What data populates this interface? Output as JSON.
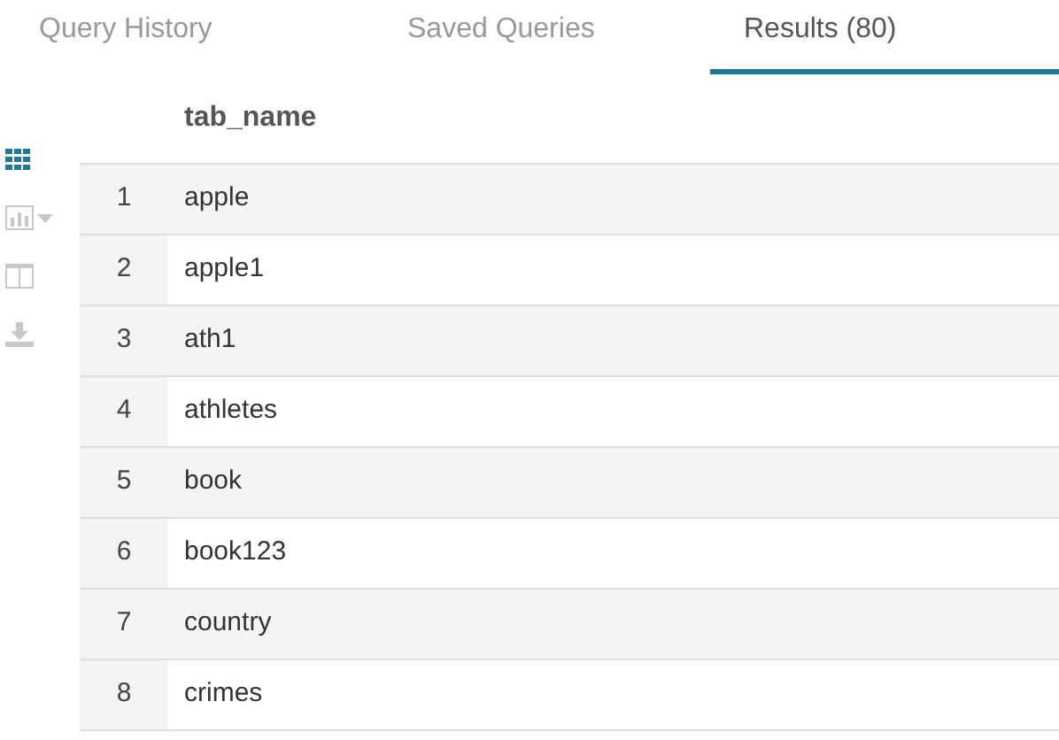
{
  "tabs": [
    {
      "label": "Query History",
      "selected": false
    },
    {
      "label": "Saved Queries",
      "selected": false
    },
    {
      "label": "Results (80)",
      "selected": true
    }
  ],
  "toolbar": [
    {
      "kind": "grid",
      "selected": true
    },
    {
      "kind": "chart",
      "selected": false
    },
    {
      "kind": "columns",
      "selected": false
    },
    {
      "kind": "download",
      "selected": false
    }
  ],
  "table": {
    "columns": [
      "tab_name"
    ],
    "rows": [
      {
        "number": "1",
        "cells": [
          "apple"
        ]
      },
      {
        "number": "2",
        "cells": [
          "apple1"
        ]
      },
      {
        "number": "3",
        "cells": [
          "ath1"
        ]
      },
      {
        "number": "4",
        "cells": [
          "athletes"
        ]
      },
      {
        "number": "5",
        "cells": [
          "book"
        ]
      },
      {
        "number": "6",
        "cells": [
          "book123"
        ]
      },
      {
        "number": "7",
        "cells": [
          "country"
        ]
      },
      {
        "number": "8",
        "cells": [
          "crimes"
        ]
      }
    ]
  }
}
